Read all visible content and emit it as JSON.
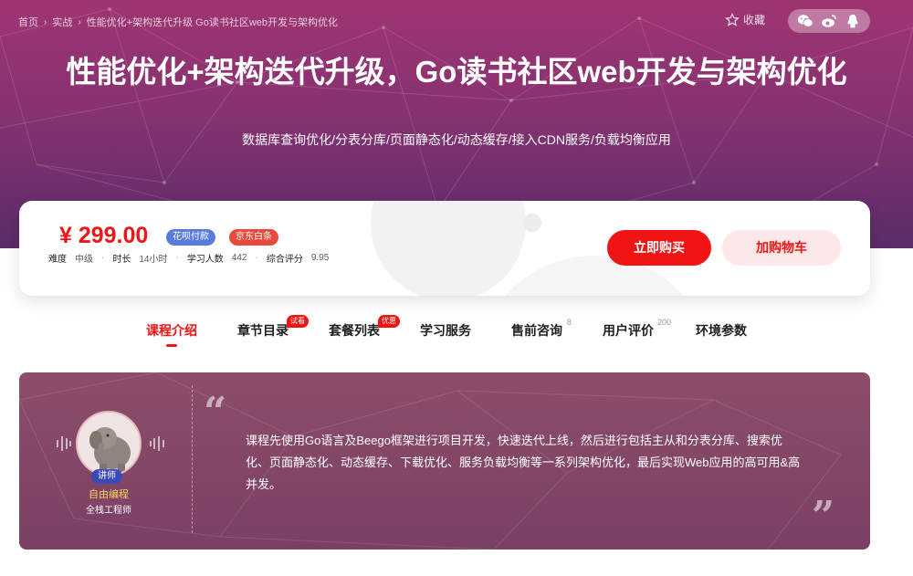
{
  "breadcrumb": [
    "首页",
    "实战",
    "性能优化+架构迭代升级 Go读书社区web开发与架构优化"
  ],
  "favorite_label": "收藏",
  "share_icons": [
    "wechat-icon",
    "weibo-icon",
    "qq-icon"
  ],
  "course": {
    "title": "性能优化+架构迭代升级，Go读书社区web开发与架构优化",
    "subtitle": "数据库查询优化/分表分库/页面静态化/动态缓存/接入CDN服务/负载均衡应用"
  },
  "purchase": {
    "price": "¥ 299.00",
    "badges": [
      "花呗付款",
      "京东白条"
    ],
    "meta": [
      {
        "key": "难度",
        "value": "中级"
      },
      {
        "key": "时长",
        "value": "14小时"
      },
      {
        "key": "学习人数",
        "value": "442"
      },
      {
        "key": "综合评分",
        "value": "9.95"
      }
    ],
    "buy_label": "立即购买",
    "cart_label": "加购物车"
  },
  "tabs": [
    {
      "label": "课程介绍",
      "active": true
    },
    {
      "label": "章节目录",
      "tag": "试看"
    },
    {
      "label": "套餐列表",
      "tag": "优惠"
    },
    {
      "label": "学习服务"
    },
    {
      "label": "售前咨询",
      "count": "8"
    },
    {
      "label": "用户评价",
      "count": "200"
    },
    {
      "label": "环境参数"
    }
  ],
  "teacher": {
    "tag": "讲师",
    "name": "自由编程",
    "role": "全栈工程师"
  },
  "intro_text": "课程先使用Go语言及Beego框架进行项目开发，快速迭代上线，然后进行包括主从和分表分库、搜索优化、页面静态化、动态缓存、下载优化、服务负载均衡等一系列架构优化，最后实现Web应用的高可用&高并发。",
  "colors": {
    "accent": "#f01414",
    "hero_top": "#a03472",
    "hero_bottom": "#5a2c6a",
    "teacher_name": "#f8d25a"
  }
}
